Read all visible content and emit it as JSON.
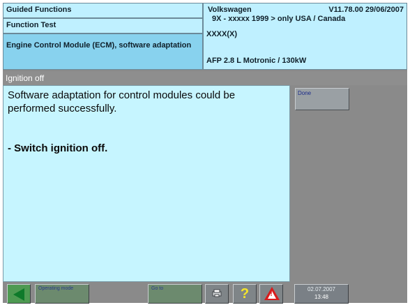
{
  "header": {
    "left": {
      "row1": "Guided Functions",
      "row2": "Function Test",
      "row3": "Engine Control Module (ECM), software adaptation"
    },
    "right": {
      "brand": "Volkswagen",
      "version": "V11.78.00 29/06/2007",
      "model": "9X - xxxxx 1999 > only USA / Canada",
      "code": "XXXX(X)",
      "engine": "AFP 2.8 L Motronic / 130kW"
    }
  },
  "status": {
    "text": "Ignition off"
  },
  "message": {
    "line1": "Software adaptation for control modules could be performed successfully.",
    "instruction": "- Switch ignition off."
  },
  "side": {
    "done_label": "Done"
  },
  "toolbar": {
    "operating_mode_label": "Operating mode",
    "goto_label": "Go to",
    "date": "02.07.2007",
    "time": "13:48",
    "help_glyph": "?",
    "warn_glyph": "!"
  },
  "icons": {
    "back": "back-arrow-icon",
    "print": "printer-icon",
    "help": "help-icon",
    "warning": "warning-icon"
  },
  "colors": {
    "header_bg": "#bff0ff",
    "header_selected_bg": "#88d2ee",
    "message_bg": "#c6f5ff",
    "chrome_gray": "#8a8a8a",
    "back_green": "#0e7a2a",
    "warning_red": "#d81c1c",
    "help_yellow": "#f5e62a"
  }
}
